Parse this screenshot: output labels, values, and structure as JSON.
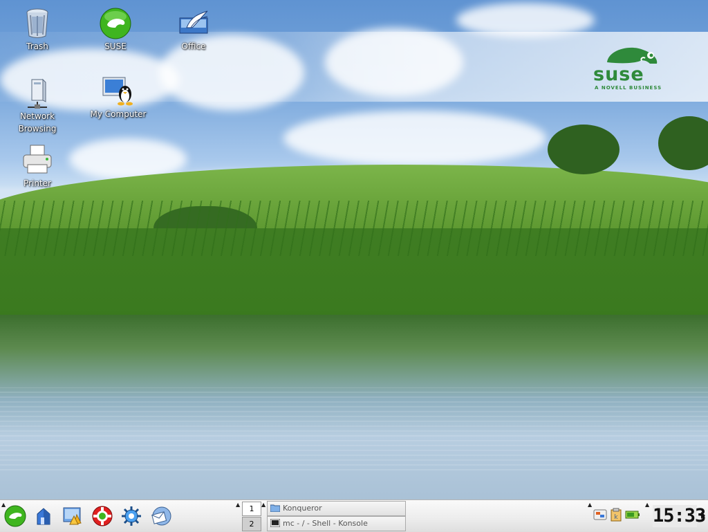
{
  "desktop": {
    "icons": [
      {
        "label": "Trash",
        "icon": "trash-icon"
      },
      {
        "label": "SUSE",
        "icon": "suse-icon"
      },
      {
        "label": "Office",
        "icon": "office-icon"
      },
      {
        "label": "Network\nBrowsing",
        "icon": "network-icon"
      },
      {
        "label": "My Computer",
        "icon": "computer-icon"
      },
      {
        "label": "Printer",
        "icon": "printer-icon"
      }
    ],
    "wallpaper": {
      "brand_word": "suse",
      "brand_tagline": "A NOVELL BUSINESS",
      "brand_color": "#2f8a3b"
    }
  },
  "panel": {
    "launchers": [
      {
        "icon": "suse-menu-icon"
      },
      {
        "icon": "home-icon"
      },
      {
        "icon": "desktop-icon"
      },
      {
        "icon": "help-lifebuoy-icon"
      },
      {
        "icon": "konqueror-gear-icon"
      },
      {
        "icon": "mail-icon"
      }
    ],
    "pager": {
      "desktops": [
        "1",
        "2"
      ],
      "active": "1"
    },
    "tasks": [
      {
        "label": "Konqueror",
        "icon": "folder-icon"
      },
      {
        "label": "mc - / - Shell - Konsole",
        "icon": "terminal-icon"
      }
    ],
    "tray": [
      {
        "icon": "network-tray-icon"
      },
      {
        "icon": "klipper-icon"
      },
      {
        "icon": "battery-icon"
      }
    ],
    "clock": "15:33"
  }
}
